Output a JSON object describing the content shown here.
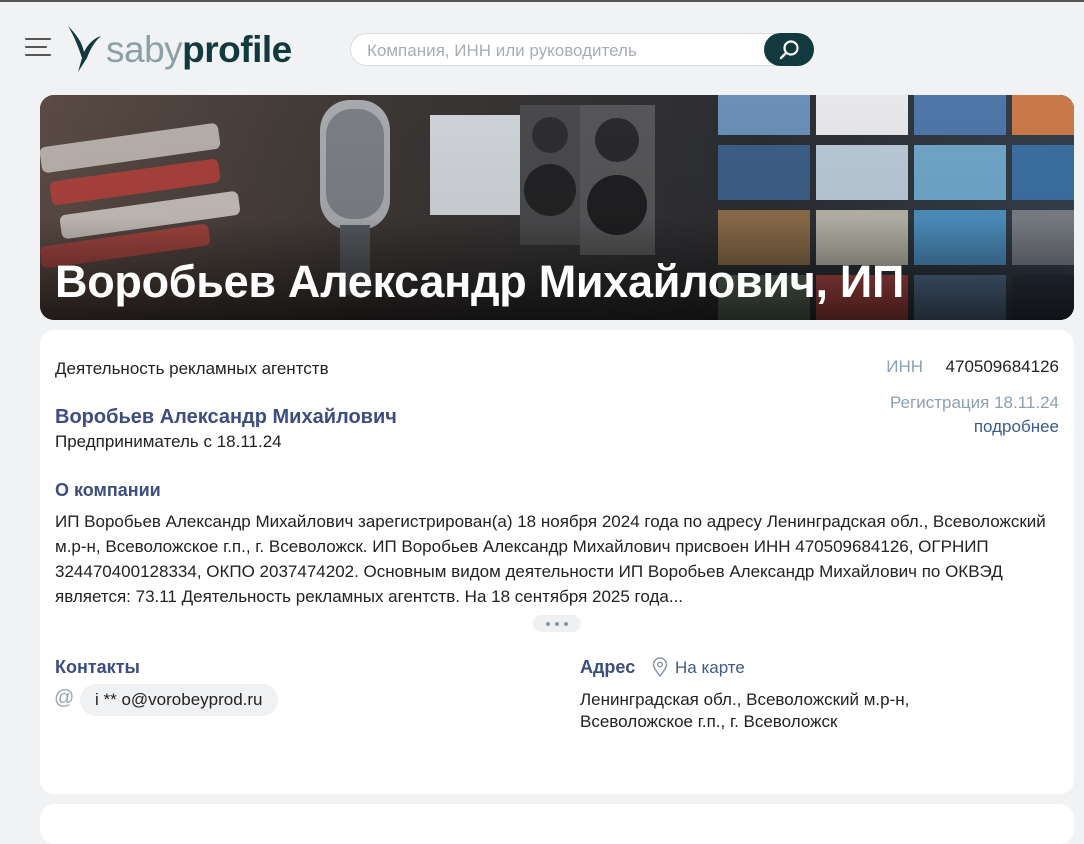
{
  "header": {
    "logo_saby": "saby",
    "logo_profile": "profile",
    "search_placeholder": "Компания, ИНН или руководитель",
    "accent_color": "#12393d"
  },
  "banner": {
    "title": "Воробьев Александр Михайлович, ИП"
  },
  "company": {
    "activity": "Деятельность рекламных агентств",
    "inn_label": "ИНН",
    "inn_value": "470509684126",
    "registration": "Регистрация 18.11.24",
    "more_link": "подробнее",
    "owner_name": "Воробьев Александр Михайлович",
    "owner_since": "Предприниматель с 18.11.24"
  },
  "about": {
    "heading": "О компании",
    "text": "ИП Воробьев Александр Михайлович зарегистрирован(а) 18 ноября 2024 года по адресу Ленинградская обл., Всеволожский м.р-н, Всеволожское г.п., г. Всеволожск. ИП Воробьев Александр Михайлович присвоен ИНН 470509684126, ОГРНИП 324470400128334, ОКПО 2037474202. Основным видом деятельности ИП Воробьев Александр Михайлович по ОКВЭД является: 73.11 Деятельность рекламных агентств. На 18 сентября 2025 года..."
  },
  "contacts": {
    "heading": "Контакты",
    "email_icon": "at-icon",
    "email": "i ** o@vorobeyprod.ru"
  },
  "address": {
    "heading": "Адрес",
    "map_icon": "map-pin-icon",
    "map_link": "На карте",
    "line1": "Ленинградская обл., Всеволожский м.р-н,",
    "line2": "Всеволожское г.п., г. Всеволожск"
  }
}
